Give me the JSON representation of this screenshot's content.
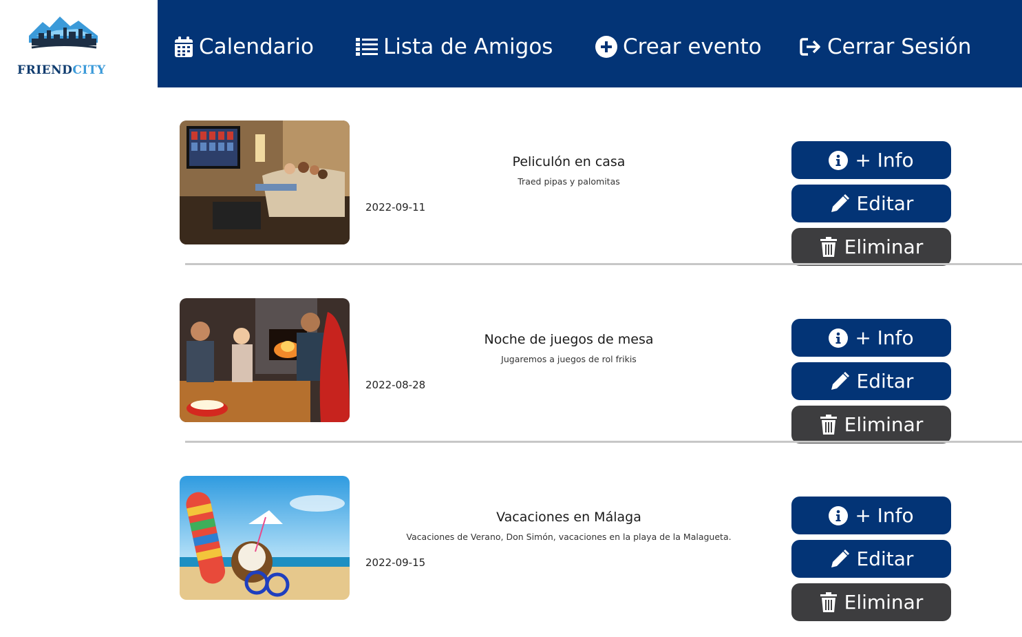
{
  "brand": {
    "part1": "FRIEND",
    "part2": "CITY",
    "logo_icon": "city-mountain-logo",
    "colors": {
      "dark": "#0e3b6e",
      "accent": "#3b9ad9"
    }
  },
  "nav": {
    "background": "#033476",
    "items": [
      {
        "label": "Calendario",
        "icon": "calendar-icon"
      },
      {
        "label": "Lista de Amigos",
        "icon": "list-icon"
      },
      {
        "label": "Crear evento",
        "icon": "plus-circle-icon"
      },
      {
        "label": "Cerrar Sesión",
        "icon": "sign-out-icon"
      }
    ]
  },
  "actions": {
    "info_label": "+ Info",
    "edit_label": "Editar",
    "delete_label": "Eliminar",
    "primary_color": "#033476",
    "danger_color": "#3d3d3f"
  },
  "events": [
    {
      "title": "Peliculón en casa",
      "description": "Traed pipas y palomitas",
      "date": "2022-09-11",
      "image": "family-movie-night-photo"
    },
    {
      "title": "Noche de juegos de mesa",
      "description": "Jugaremos a juegos de rol frikis",
      "date": "2022-08-28",
      "image": "board-game-night-photo"
    },
    {
      "title": "Vacaciones en Málaga",
      "description": "Vacaciones de Verano, Don Simón, vacaciones en la playa de la Malagueta.",
      "date": "2022-09-15",
      "image": "beach-flipflops-photo"
    }
  ]
}
